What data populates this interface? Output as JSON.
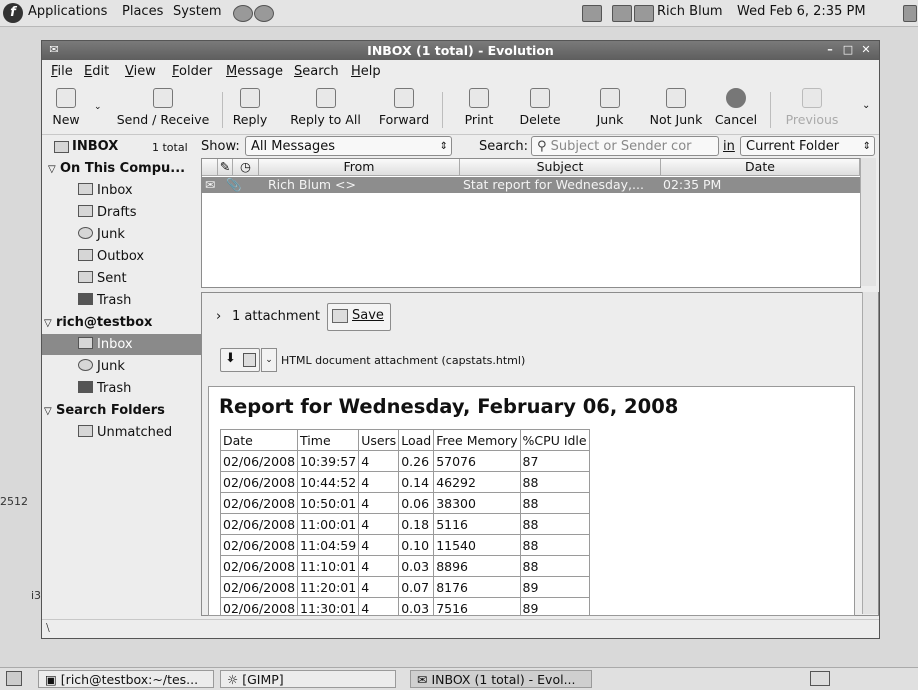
{
  "top_panel": {
    "menus": [
      "Applications",
      "Places",
      "System"
    ],
    "user": "Rich Blum",
    "clock": "Wed Feb 6, 2:35 PM"
  },
  "desktop": {
    "label_1": "2512",
    "label_2": "i3"
  },
  "window": {
    "title": "INBOX (1 total) - Evolution",
    "menu": [
      "File",
      "Edit",
      "View",
      "Folder",
      "Message",
      "Search",
      "Help"
    ],
    "toolbar": {
      "new": "New",
      "send_receive": "Send / Receive",
      "reply": "Reply",
      "reply_all": "Reply to All",
      "forward": "Forward",
      "print": "Print",
      "delete": "Delete",
      "junk": "Junk",
      "not_junk": "Not Junk",
      "cancel": "Cancel",
      "previous": "Previous"
    }
  },
  "folder_pane": {
    "header": "INBOX",
    "count": "1 total",
    "items": [
      {
        "label": "On This Compu...",
        "kind": "group"
      },
      {
        "label": "Inbox",
        "kind": "folder"
      },
      {
        "label": "Drafts",
        "kind": "folder"
      },
      {
        "label": "Junk",
        "kind": "folder"
      },
      {
        "label": "Outbox",
        "kind": "folder"
      },
      {
        "label": "Sent",
        "kind": "folder"
      },
      {
        "label": "Trash",
        "kind": "folder"
      },
      {
        "label": "rich@testbox",
        "kind": "group"
      },
      {
        "label": "Inbox",
        "kind": "folder",
        "selected": true
      },
      {
        "label": "Junk",
        "kind": "folder"
      },
      {
        "label": "Trash",
        "kind": "folder"
      },
      {
        "label": "Search Folders",
        "kind": "group"
      },
      {
        "label": "Unmatched",
        "kind": "folder"
      }
    ]
  },
  "filter_bar": {
    "show_label": "Show:",
    "show_value": "All Messages",
    "search_label": "Search:",
    "search_placeholder": "Subject or Sender cor",
    "in_label": "in",
    "scope_value": "Current Folder"
  },
  "message_list": {
    "columns": {
      "from": "From",
      "subject": "Subject",
      "date": "Date"
    },
    "rows": [
      {
        "from": "Rich Blum <>",
        "subject": "Stat report for Wednesday,...",
        "date": "02:35 PM"
      }
    ]
  },
  "preview": {
    "attachment_count": "1 attachment",
    "save_label": "Save",
    "attachment_desc": "HTML document attachment (capstats.html)",
    "report_title": "Report for Wednesday, February 06, 2008",
    "table_headers": [
      "Date",
      "Time",
      "Users",
      "Load",
      "Free Memory",
      "%CPU Idle"
    ],
    "table_rows": [
      [
        "02/06/2008",
        "10:39:57",
        "4",
        "0.26",
        "57076",
        "87"
      ],
      [
        "02/06/2008",
        "10:44:52",
        "4",
        "0.14",
        "46292",
        "88"
      ],
      [
        "02/06/2008",
        "10:50:01",
        "4",
        "0.06",
        "38300",
        "88"
      ],
      [
        "02/06/2008",
        "11:00:01",
        "4",
        "0.18",
        "5116",
        "88"
      ],
      [
        "02/06/2008",
        "11:04:59",
        "4",
        "0.10",
        "11540",
        "88"
      ],
      [
        "02/06/2008",
        "11:10:01",
        "4",
        "0.03",
        "8896",
        "88"
      ],
      [
        "02/06/2008",
        "11:20:01",
        "4",
        "0.07",
        "8176",
        "89"
      ],
      [
        "02/06/2008",
        "11:30:01",
        "4",
        "0.03",
        "7516",
        "89"
      ]
    ]
  },
  "taskbar": {
    "tasks": [
      "[rich@testbox:~/tes...",
      "[GIMP]",
      "INBOX (1 total) - Evol..."
    ]
  }
}
